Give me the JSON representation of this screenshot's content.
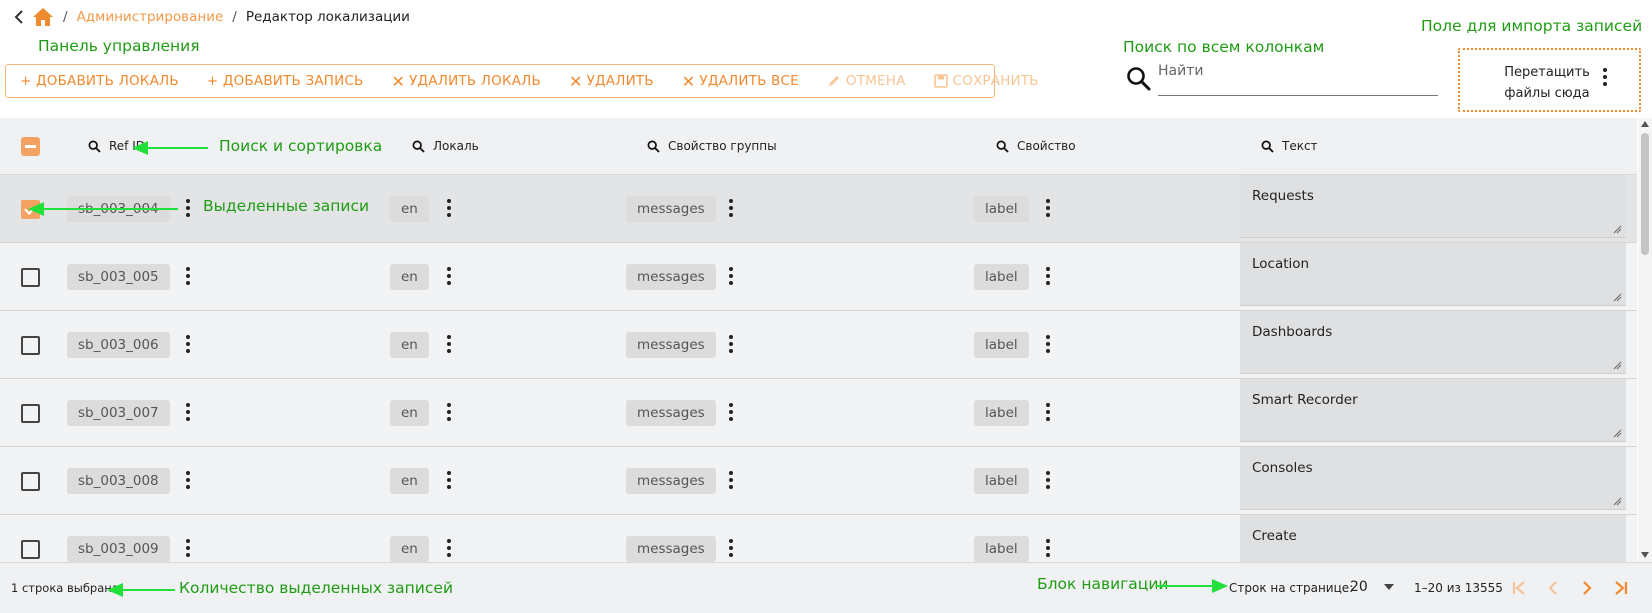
{
  "breadcrumb": {
    "items": [
      {
        "label": "Администрирование"
      },
      {
        "label": "Редактор локализации"
      }
    ]
  },
  "annotations": {
    "control_panel": "Панель управления",
    "search_all": "Поиск по всем колонкам",
    "import_field": "Поле для импорта записей",
    "search_sort": "Поиск и сортировка",
    "selected_records": "Выделенные записи",
    "selected_count": "Количество выделенных записей",
    "navigation": "Блок навигации"
  },
  "toolbar": {
    "add_locale": "+ ДОБАВИТЬ ЛОКАЛЬ",
    "add_record": "+ ДОБАВИТЬ ЗАПИСЬ",
    "delete_locale": "УДАЛИТЬ ЛОКАЛЬ",
    "delete": "УДАЛИТЬ",
    "delete_all": "УДАЛИТЬ ВСЕ",
    "cancel": "ОТМЕНА",
    "save": "СОХРАНИТЬ"
  },
  "search": {
    "placeholder": "Найти"
  },
  "dropzone": {
    "line1": "Перетащить",
    "line2": "файлы сюда"
  },
  "columns": {
    "ref_id": "Ref ID",
    "locale": "Локаль",
    "group_property": "Свойство группы",
    "property": "Свойство",
    "text": "Текст"
  },
  "rows": [
    {
      "ref_id": "sb_003_004",
      "locale": "en",
      "group": "messages",
      "property": "label",
      "text": "Requests",
      "selected": true
    },
    {
      "ref_id": "sb_003_005",
      "locale": "en",
      "group": "messages",
      "property": "label",
      "text": "Location",
      "selected": false
    },
    {
      "ref_id": "sb_003_006",
      "locale": "en",
      "group": "messages",
      "property": "label",
      "text": "Dashboards",
      "selected": false
    },
    {
      "ref_id": "sb_003_007",
      "locale": "en",
      "group": "messages",
      "property": "label",
      "text": "Smart Recorder",
      "selected": false
    },
    {
      "ref_id": "sb_003_008",
      "locale": "en",
      "group": "messages",
      "property": "label",
      "text": "Consoles",
      "selected": false
    },
    {
      "ref_id": "sb_003_009",
      "locale": "en",
      "group": "messages",
      "property": "label",
      "text": "Create",
      "selected": false
    }
  ],
  "footer": {
    "selected_text": "1 строка выбрана",
    "rows_per_page_label": "Строк на странице:",
    "rows_per_page_value": "20",
    "range": "1–20 из 13555"
  },
  "colors": {
    "accent": "#f08a30",
    "annotation": "#1f9c14",
    "arrow": "#22e03a"
  },
  "icons": [
    "back-chevron-icon",
    "home-icon",
    "search-icon",
    "close-x-icon",
    "pencil-icon",
    "save-disk-icon",
    "kebab-menu-icon",
    "dropdown-arrow-icon",
    "first-page-icon",
    "prev-page-icon",
    "next-page-icon",
    "last-page-icon",
    "resize-grip-icon"
  ]
}
